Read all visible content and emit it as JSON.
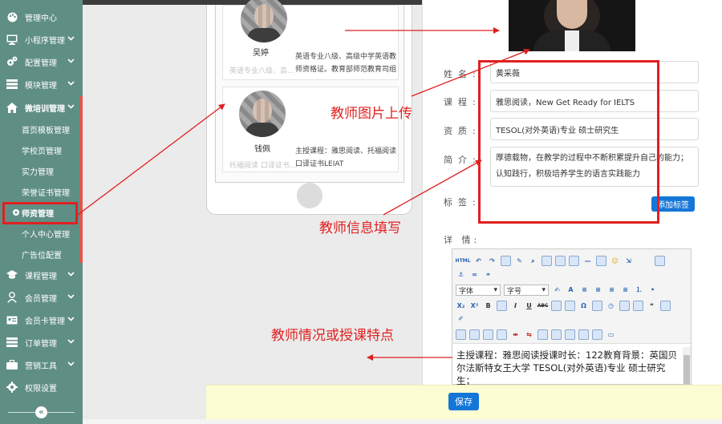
{
  "sidebar": {
    "items": [
      {
        "label": "管理中心",
        "icon": "palette-icon",
        "chevron": false
      },
      {
        "label": "小程序管理",
        "icon": "monitor-icon",
        "chevron": true
      },
      {
        "label": "配置管理",
        "icon": "cogs-icon",
        "chevron": true
      },
      {
        "label": "模块管理",
        "icon": "list-icon",
        "chevron": true
      },
      {
        "label": "微培训管理",
        "icon": "home-icon",
        "chevron": true
      },
      {
        "label": "首页模板管理",
        "icon": "",
        "chevron": false
      },
      {
        "label": "学校页管理",
        "icon": "",
        "chevron": false
      },
      {
        "label": "实力管理",
        "icon": "",
        "chevron": false
      },
      {
        "label": "荣誉证书管理",
        "icon": "",
        "chevron": false
      },
      {
        "label": "师资管理",
        "icon": "gear-icon",
        "chevron": false
      },
      {
        "label": "个人中心管理",
        "icon": "",
        "chevron": false
      },
      {
        "label": "广告位配置",
        "icon": "",
        "chevron": false
      },
      {
        "label": "课程管理",
        "icon": "graduation-cap-icon",
        "chevron": true
      },
      {
        "label": "会员管理",
        "icon": "user-icon",
        "chevron": true
      },
      {
        "label": "会员卡管理",
        "icon": "id-card-icon",
        "chevron": true
      },
      {
        "label": "订单管理",
        "icon": "list-icon",
        "chevron": true
      },
      {
        "label": "营销工具",
        "icon": "briefcase-icon",
        "chevron": true
      },
      {
        "label": "权限设置",
        "icon": "gear-icon",
        "chevron": false
      }
    ],
    "collapse_icon": "double-chevron-left-icon"
  },
  "preview": {
    "teachers": [
      {
        "name": "吴婷",
        "desc1": "英语专业八级、高级中学英语教",
        "desc2": "师资格证。教育部师范教育司组",
        "tags": "英语专业八级、高..."
      },
      {
        "name": "钱佩",
        "desc1": "主授课程：雅思阅读、托福阅读",
        "desc2": "口译证书LEIAT",
        "tags": "托福阅读 口译证书..."
      }
    ]
  },
  "form": {
    "fields": {
      "name": {
        "label": "姓名:",
        "value": "黄采薇"
      },
      "course": {
        "label": "课程:",
        "value": "雅思阅读，New Get Ready for IELTS"
      },
      "qualification": {
        "label": "资质:",
        "value": "TESOL(对外英语)专业 硕士研究生"
      },
      "intro": {
        "label": "简介:",
        "value": "厚德载物，在教学的过程中不断积累提升自己的能力；认知践行，积极培养学生的语言实践能力"
      },
      "tag": {
        "label": "标签:"
      }
    },
    "add_tag_button": "添加标签",
    "detail_label": "详 情:",
    "editor": {
      "font_family_placeholder": "字体",
      "font_size_placeholder": "字号",
      "content": "主授课程：雅思阅读授课时长：122教育背景：英国贝尔法斯特女王大学 TESOL(对外英语)专业 硕士研究生；"
    },
    "save_button": "保存"
  },
  "annotations": {
    "photo_upload": "教师图片上传",
    "info_fill": "教师信息填写",
    "teaching_features": "教师情况或授课特点"
  },
  "colors": {
    "sidebar_bg": "#5f8e85",
    "accent_blue": "#1576d8",
    "annotation_red": "#e02020",
    "save_bar_bg": "#fdfdd3"
  }
}
